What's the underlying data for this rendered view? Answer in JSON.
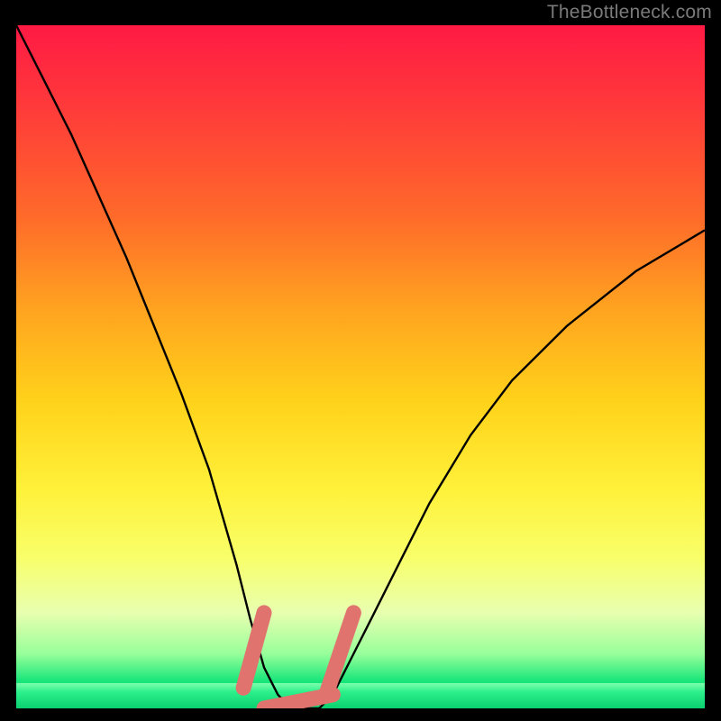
{
  "watermark": "TheBottleneck.com",
  "colors": {
    "background": "#000000",
    "gradient_top": "#ff1a44",
    "gradient_mid": "#fff13a",
    "gradient_bottom": "#18e67a",
    "curve": "#000000",
    "marker": "#e0736e"
  },
  "chart_data": {
    "type": "line",
    "title": "",
    "xlabel": "",
    "ylabel": "",
    "xlim": [
      0,
      100
    ],
    "ylim": [
      0,
      100
    ],
    "grid": false,
    "legend": false,
    "series": [
      {
        "name": "bottleneck-curve",
        "x": [
          0,
          4,
          8,
          12,
          16,
          20,
          24,
          28,
          32,
          34,
          36,
          38,
          40,
          42,
          44,
          46,
          48,
          52,
          56,
          60,
          66,
          72,
          80,
          90,
          100
        ],
        "y": [
          100,
          92,
          84,
          75,
          66,
          56,
          46,
          35,
          21,
          13,
          6,
          2,
          0,
          0,
          0,
          2,
          6,
          14,
          22,
          30,
          40,
          48,
          56,
          64,
          70
        ]
      }
    ],
    "markers": [
      {
        "name": "valley-left-slope",
        "shape": "pill",
        "x_range": [
          33,
          36
        ],
        "y_range": [
          3,
          14
        ]
      },
      {
        "name": "valley-floor",
        "shape": "pill",
        "x_range": [
          36,
          46
        ],
        "y_range": [
          0,
          2
        ]
      },
      {
        "name": "valley-right-slope",
        "shape": "pill",
        "x_range": [
          45,
          49
        ],
        "y_range": [
          2,
          14
        ]
      }
    ],
    "annotations": [
      {
        "text": "TheBottleneck.com",
        "position": "top-right"
      }
    ]
  }
}
